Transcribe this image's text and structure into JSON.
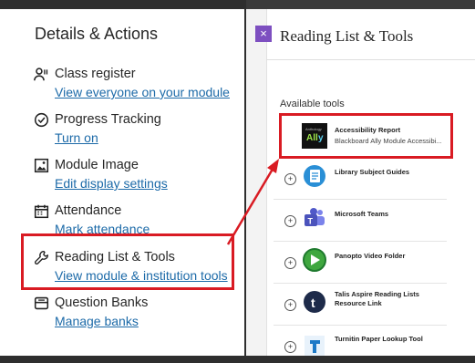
{
  "left_panel": {
    "title": "Details & Actions",
    "items": [
      {
        "label": "Class register",
        "link": "View everyone on your module",
        "icon": "class-register-icon"
      },
      {
        "label": "Progress Tracking",
        "link": "Turn on",
        "icon": "check-circle-icon"
      },
      {
        "label": "Module Image",
        "link": "Edit display settings",
        "icon": "image-icon"
      },
      {
        "label": "Attendance",
        "link": "Mark attendance",
        "icon": "calendar-icon"
      },
      {
        "label": "Reading List & Tools",
        "link": "View module & institution tools",
        "icon": "wrench-icon"
      },
      {
        "label": "Question Banks",
        "link": "Manage banks",
        "icon": "question-bank-icon"
      }
    ]
  },
  "right_panel": {
    "close_label": "×",
    "title": "Reading List & Tools",
    "section_label": "Available tools",
    "tools": [
      {
        "name": "Accessibility Report",
        "subtitle": "Blackboard Ally Module Accessibi...",
        "icon": "ally-logo-icon"
      },
      {
        "name": "Library Subject Guides",
        "subtitle": "",
        "icon": "library-guides-icon"
      },
      {
        "name": "Microsoft Teams",
        "subtitle": "",
        "icon": "teams-icon"
      },
      {
        "name": "Panopto Video Folder",
        "subtitle": "",
        "icon": "panopto-icon"
      },
      {
        "name": "Talis Aspire Reading Lists Resource Link",
        "subtitle": "",
        "icon": "talis-icon"
      },
      {
        "name": "Turnitin Paper Lookup Tool",
        "subtitle": "",
        "icon": "turnitin-icon"
      }
    ]
  },
  "colors": {
    "highlight": "#d91b23",
    "link": "#1c6aa8",
    "accent": "#7d4fc0"
  }
}
